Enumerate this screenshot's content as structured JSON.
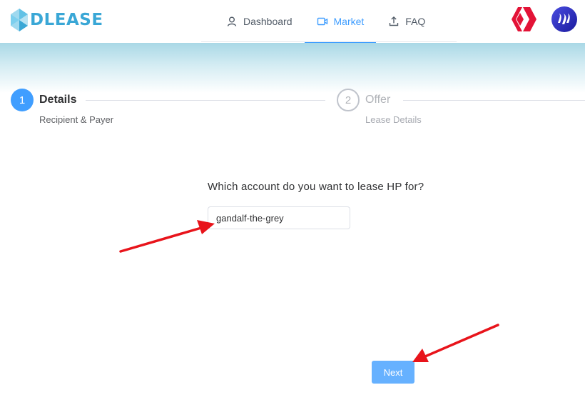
{
  "brand": {
    "name": "DLEASE",
    "color": "#3aa7d6"
  },
  "nav": {
    "items": [
      {
        "label": "Dashboard",
        "icon": "user-icon",
        "active": false
      },
      {
        "label": "Market",
        "icon": "video-camera-icon",
        "active": true
      },
      {
        "label": "FAQ",
        "icon": "upload-icon",
        "active": false
      }
    ],
    "active_color": "#409eff"
  },
  "accounts": {
    "hive_icon": "hive-logo-icon",
    "steem_icon": "steem-logo-icon"
  },
  "steps": [
    {
      "number": "1",
      "title": "Details",
      "description": "Recipient & Payer",
      "status": "active"
    },
    {
      "number": "2",
      "title": "Offer",
      "description": "Lease Details",
      "status": "pending"
    }
  ],
  "form": {
    "question": "Which account do you want to lease HP for?",
    "account_value": "gandalf-the-grey",
    "next_label": "Next"
  },
  "annotation_color": "#e8141b"
}
